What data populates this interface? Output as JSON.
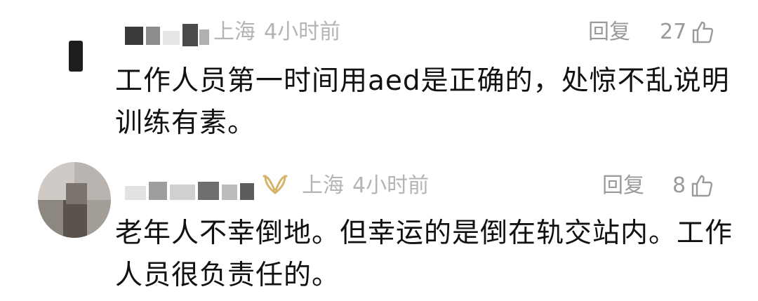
{
  "comments": [
    {
      "location": "上海",
      "time": "4小时前",
      "reply_label": "回复",
      "like_count": "27",
      "text": "工作人员第一时间用aed是正确的，处惊不乱说明训练有素。"
    },
    {
      "location": "上海",
      "time": "4小时前",
      "reply_label": "回复",
      "like_count": "8",
      "text": "老年人不幸倒地。但幸运的是倒在轨交站内。工作人员很负责任的。"
    }
  ],
  "colors": {
    "meta_text": "#b4b4b4",
    "action_text": "#9a9a9a",
    "body_text": "#111111",
    "vip_badge": "#d8b46a"
  },
  "icons": {
    "like": "thumbs-up-icon",
    "vip": "vip-badge-icon"
  }
}
